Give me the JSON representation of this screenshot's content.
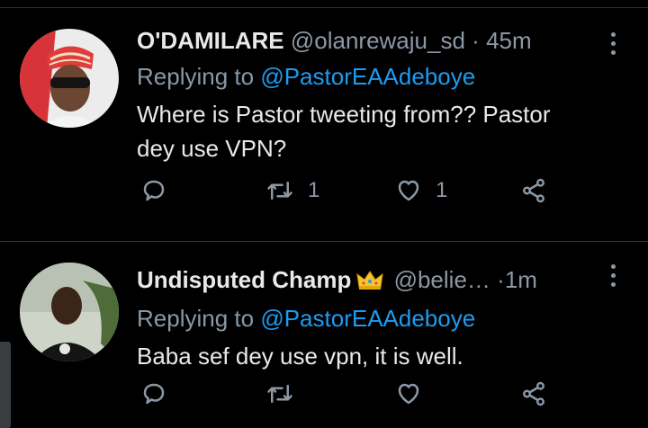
{
  "tweets": [
    {
      "name": "O'DAMILARE",
      "handle": "@olanrewaju_sd",
      "dot": "·",
      "time": "45m",
      "replying_prefix": "Replying to",
      "replying_to": "@PastorEAAdeboye",
      "text_line1": "Where is Pastor tweeting from?? Pastor",
      "text_line2": "dey use VPN?",
      "retweets": "1",
      "likes": "1"
    },
    {
      "name": "Undisputed Champ",
      "handle": "@belie…",
      "dot": "·",
      "time": "1m",
      "replying_prefix": "Replying to",
      "replying_to": "@PastorEAAdeboye",
      "text_line1": "Baba sef dey use vpn, it is well.",
      "retweets": "",
      "likes": ""
    }
  ],
  "icons": {
    "reply": "reply-icon",
    "retweet": "retweet-icon",
    "like": "heart-icon",
    "share": "share-icon",
    "more": "more-icon",
    "crown": "crown-icon"
  },
  "colors": {
    "background": "#000000",
    "text": "#e7e9ea",
    "secondary": "#8b98a5",
    "mention": "#1d9bf0",
    "divider": "#2f3336"
  }
}
